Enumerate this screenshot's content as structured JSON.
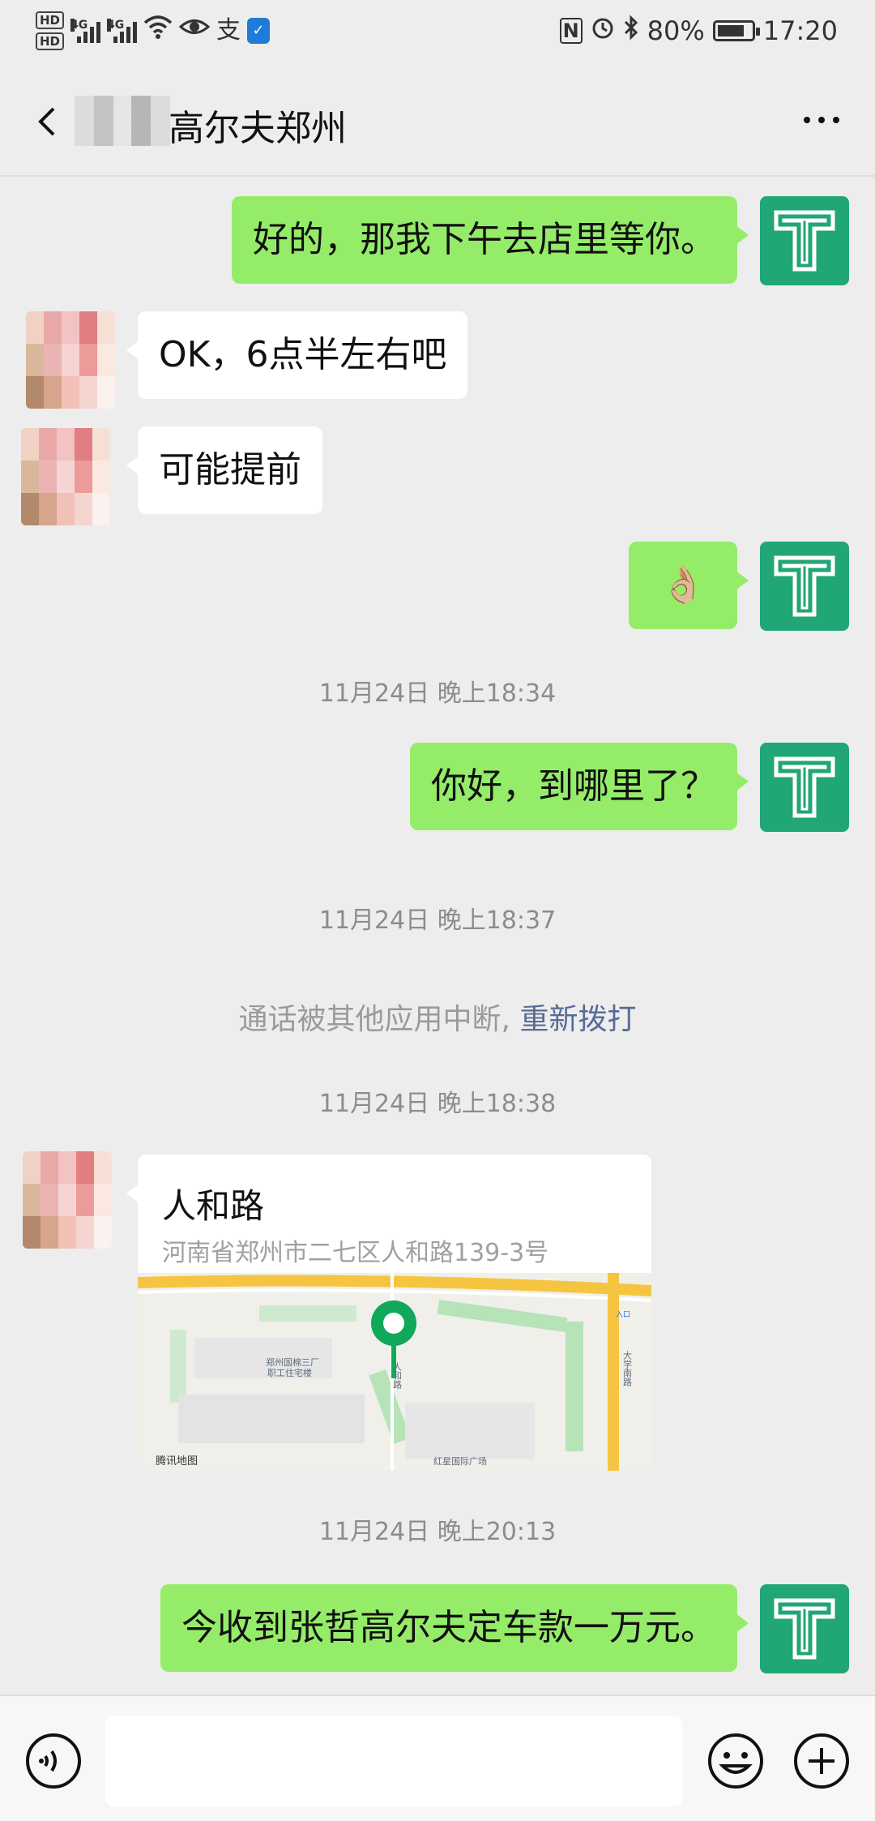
{
  "status_bar": {
    "hd1": "HD",
    "hd2": "HD",
    "network1": "4G",
    "network2": "4G",
    "alipay_glyph": "支",
    "nfc": "N",
    "battery": "80%",
    "battery_level": 0.8,
    "time": "17:20",
    "icons": [
      "signal-icon",
      "wifi-icon",
      "eye-icon",
      "alipay-icon",
      "shield-icon",
      "nfc-icon",
      "alarm-icon",
      "bluetooth-icon",
      "battery-icon"
    ]
  },
  "header": {
    "title": "高尔夫郑州",
    "back_icon": "chevron-left-icon",
    "more_icon": "more-dots-icon"
  },
  "messages": {
    "m1": "好的，那我下午去店里等你。",
    "m2": "OK，6点半左右吧",
    "m3": "可能提前",
    "m4": "👌🏼",
    "ts1": "11月24日 晚上18:34",
    "m5": "你好，到哪里了？",
    "ts2": "11月24日 晚上18:37",
    "sys_text": "通话被其他应用中断, ",
    "sys_link": "重新拨打",
    "ts3": "11月24日 晚上18:38",
    "location": {
      "name": "人和路",
      "address": "河南省郑州市二七区人和路139-3号",
      "map_provider": "腾讯地图",
      "map_label_1": "郑州国棉三厂",
      "map_label_2": "职工住宅楼",
      "map_label_3": "红星国际广场",
      "map_label_4": "大学南路",
      "map_label_5": "人和路",
      "map_label_6": "入口"
    },
    "ts4": "11月24日 晚上20:13",
    "m6": "今收到张哲高尔夫定车款一万元。"
  },
  "input_bar": {
    "voice_icon": "voice-icon",
    "emoji_icon": "emoji-icon",
    "plus_icon": "plus-icon",
    "text_value": ""
  },
  "colors": {
    "background": "#ededed",
    "my_bubble": "#95ec69",
    "other_bubble": "#ffffff",
    "avatar_me": "#21a675",
    "link": "#576b95"
  }
}
